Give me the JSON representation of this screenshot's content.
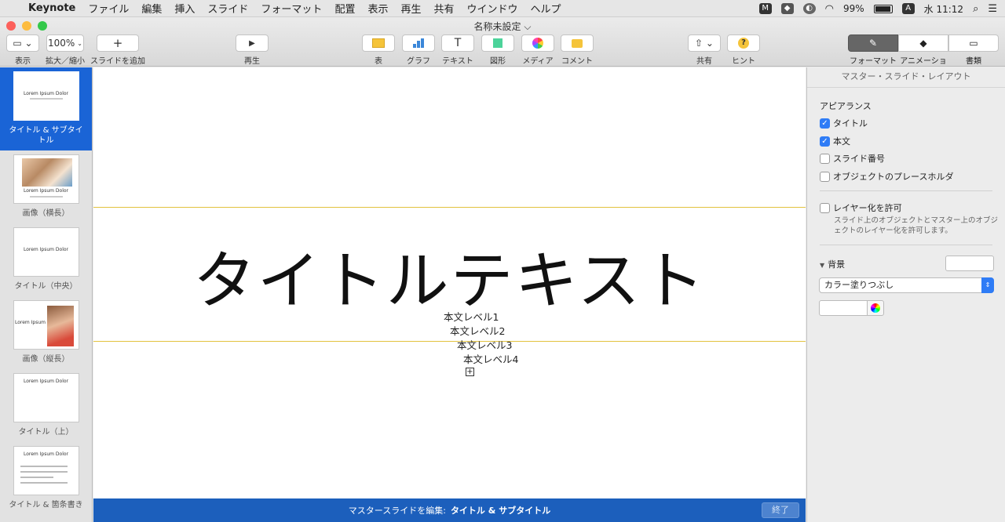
{
  "menubar": {
    "apple": "",
    "app_name": "Keynote",
    "items": [
      "ファイル",
      "編集",
      "挿入",
      "スライド",
      "フォーマット",
      "配置",
      "表示",
      "再生",
      "共有",
      "ウインドウ",
      "ヘルプ"
    ],
    "battery": "99%",
    "input_source": "A",
    "clock": "水 11:12"
  },
  "window": {
    "title": "名称未設定 ⌵"
  },
  "toolbar": {
    "view_label": "表示",
    "zoom_value": "100%",
    "zoom_label": "拡大／縮小",
    "add_slide_label": "スライドを追加",
    "play_label": "再生",
    "table_label": "表",
    "chart_label": "グラフ",
    "text_label": "テキスト",
    "shape_label": "図形",
    "media_label": "メディア",
    "comment_label": "コメント",
    "share_label": "共有",
    "hint_label": "ヒント",
    "format_label": "フォーマット",
    "animate_label": "アニメーション",
    "document_label": "書類"
  },
  "navigator": {
    "slides": [
      {
        "label": "タイトル & サブタイトル",
        "thumb_title": "Lorem Ipsum Dolor"
      },
      {
        "label": "画像（横長）",
        "thumb_title": "Lorem Ipsum Dolor"
      },
      {
        "label": "タイトル（中央）",
        "thumb_title": "Lorem Ipsum Dolor"
      },
      {
        "label": "画像（縦長）",
        "thumb_title": "Lorem Ipsum"
      },
      {
        "label": "タイトル（上）",
        "thumb_title": "Lorem Ipsum Dolor"
      },
      {
        "label": "タイトル & 箇条書き",
        "thumb_title": "Lorem Ipsum Dolor"
      }
    ]
  },
  "canvas": {
    "title": "タイトルテキスト",
    "body_levels": [
      "本文レベル1",
      "本文レベル2",
      "本文レベル3",
      "本文レベル4"
    ]
  },
  "bottom_bar": {
    "prefix": "マスタースライドを編集:",
    "slide_name": "タイトル & サブタイトル",
    "done": "終了"
  },
  "inspector": {
    "header": "マスター・スライド・レイアウト",
    "appearance_title": "アピアランス",
    "title_check": "タイトル",
    "body_check": "本文",
    "slide_number_check": "スライド番号",
    "object_placeholder_check": "オブジェクトのプレースホルダ",
    "allow_layering": "レイヤー化を許可",
    "layering_hint": "スライド上のオブジェクトとマスター上のオブジェクトのレイヤー化を許可します。",
    "background_title": "背景",
    "fill_type": "カラー塗りつぶし"
  },
  "colors": {
    "accent": "#1c5fbc",
    "selection": "#1a64d6",
    "guide": "#e2c23e"
  }
}
